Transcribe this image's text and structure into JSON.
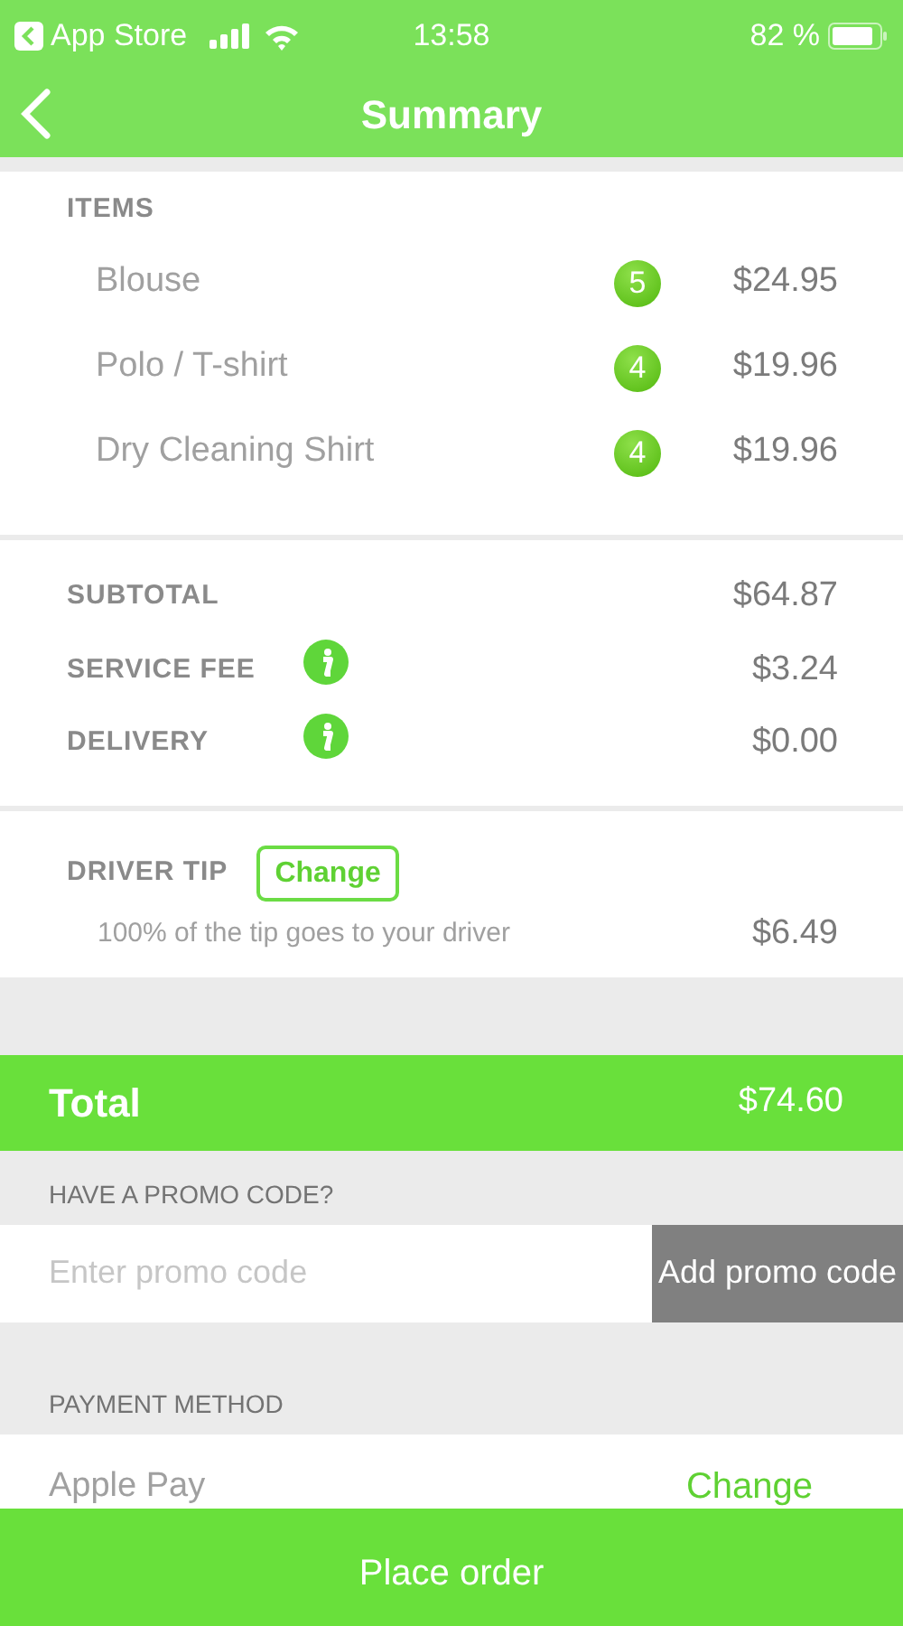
{
  "status_bar": {
    "back_app": "App Store",
    "time": "13:58",
    "battery": "82 %"
  },
  "nav": {
    "title": "Summary"
  },
  "items": {
    "heading": "ITEMS",
    "rows": [
      {
        "name": "Blouse",
        "quantity": "5",
        "price": "$24.95"
      },
      {
        "name": "Polo / T-shirt",
        "quantity": "4",
        "price": "$19.96"
      },
      {
        "name": "Dry Cleaning Shirt",
        "quantity": "4",
        "price": "$19.96"
      }
    ]
  },
  "charges": [
    {
      "label": "SUBTOTAL",
      "value": "$64.87",
      "info": false
    },
    {
      "label": "SERVICE FEE",
      "value": "$3.24",
      "info": true
    },
    {
      "label": "DELIVERY",
      "value": "$0.00",
      "info": true
    }
  ],
  "tip": {
    "label": "DRIVER TIP",
    "button": "Change",
    "note": "100% of the tip goes to your driver",
    "value": "$6.49"
  },
  "total": {
    "label": "Total",
    "value": "$74.60"
  },
  "promo": {
    "heading": "HAVE A PROMO CODE?",
    "placeholder": "Enter promo code",
    "button": "Add promo code"
  },
  "payment": {
    "heading": "PAYMENT METHOD",
    "method": "Apple Pay",
    "change": "Change"
  },
  "place_order": "Place order"
}
